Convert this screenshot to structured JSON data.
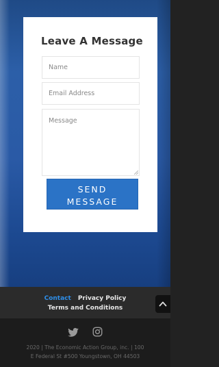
{
  "form": {
    "title": "Leave A Message",
    "name_placeholder": "Name",
    "email_placeholder": "Email Address",
    "message_placeholder": "Message",
    "send_label_line1": "SEND",
    "send_label_line2": "MESSAGE"
  },
  "footer": {
    "links": [
      "Contact",
      "Privacy Policy",
      "Terms and Conditions"
    ],
    "active_link": "Contact",
    "social_icons": [
      "twitter-icon",
      "instagram-icon"
    ],
    "copyright_line1": "2020 | The Economic Action Group, inc. | 100",
    "copyright_line2": "E Federal St #500 Youngstown, OH 44503"
  },
  "colors": {
    "accent": "#2b73c6",
    "active_link": "#2e8ee8",
    "hero_blue": "#2c5fa8",
    "footer_bg": "#2b2b2b",
    "bottom_bg": "#1c1c1c"
  }
}
